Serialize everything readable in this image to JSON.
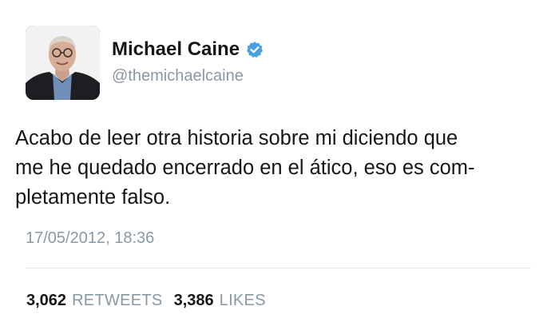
{
  "author": {
    "display_name": "Michael Caine",
    "handle": "@themichaelcaine",
    "verified_icon": "verified-badge-icon",
    "verified_color": "#4a9fe0"
  },
  "tweet": {
    "text_lines": [
      "Acabo de leer otra historia sobre mi diciendo que",
      "me he quedado encerrado en el ático, eso es com-",
      "pletamente falso."
    ],
    "timestamp": "17/05/2012, 18:36"
  },
  "stats": {
    "retweets_count": "3,062",
    "retweets_label": "RETWEETS",
    "likes_count": "3,386",
    "likes_label": "LIKES"
  }
}
